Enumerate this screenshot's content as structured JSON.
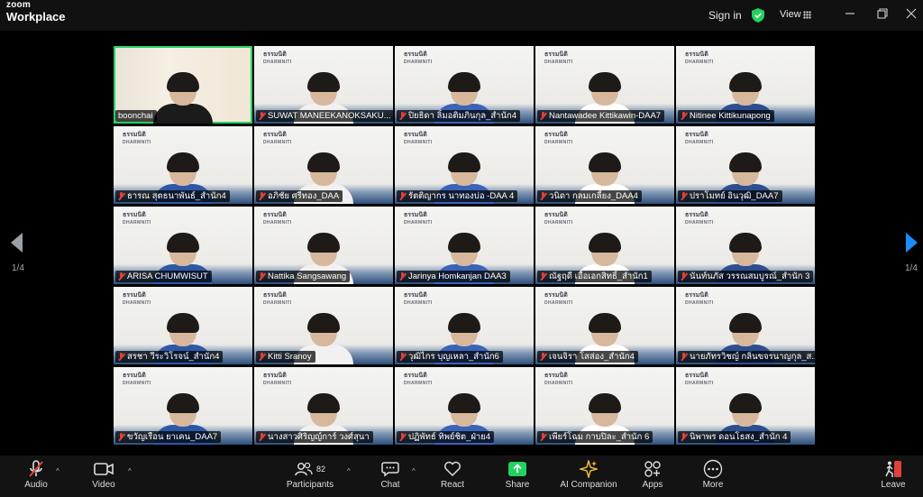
{
  "app": {
    "brand_top": "zoom",
    "brand_bottom": "Workplace",
    "signin": "Sign in",
    "view": "View"
  },
  "pager": {
    "left": "1/4",
    "right": "1/4"
  },
  "colors": {
    "active_border": "#23d160",
    "next_arrow": "#1a8cff",
    "muted_mic": "#e0413b",
    "toolbar_bg": "#131313"
  },
  "logo_text": {
    "thai": "ธรรมนิติ",
    "latin": "DHARMNITI"
  },
  "participants": [
    {
      "name": "boonchai",
      "muted": false,
      "active": true
    },
    {
      "name": "SUWAT MANEEKANOKSAKU...",
      "muted": true
    },
    {
      "name": "ปิยธิดา ลิ้มอติมภินกุล_สำนัก4",
      "muted": true
    },
    {
      "name": "Nantawadee Kittikawin-DAA7",
      "muted": true
    },
    {
      "name": "Nitinee Kittikunapong",
      "muted": true
    },
    {
      "name": "ธารณ สุตธนาพันธ์_สำนัก4",
      "muted": true
    },
    {
      "name": "อภิชัย ศรีทอง_DAA",
      "muted": true
    },
    {
      "name": "รัตติญากร นาทองบ่อ -DAA 4",
      "muted": true
    },
    {
      "name": "วนิดา กลมเกลี้ยง_DAA4",
      "muted": true
    },
    {
      "name": "ปราโมทย์ อินวุฒิ_DAA7",
      "muted": true
    },
    {
      "name": "ARISA CHUMWISUT",
      "muted": true
    },
    {
      "name": "Nattika Sangsawang",
      "muted": true
    },
    {
      "name": "Jarinya Homkanjan DAA3",
      "muted": true
    },
    {
      "name": "ณัฐฤดี เอื้อเอกสิทธิ์_สำนัก1",
      "muted": true
    },
    {
      "name": "นันท์นภัส วรรณสมบูรณ์_สำนัก 3",
      "muted": true
    },
    {
      "name": "สรชา วีระวิโรจน์_สำนัก4",
      "muted": true
    },
    {
      "name": "Kitti Sranoy",
      "muted": true
    },
    {
      "name": "วุฒิไกร บุญเหลา_สำนัก6",
      "muted": true
    },
    {
      "name": "เจนจิรา โสส่อง_สำนัก4",
      "muted": true
    },
    {
      "name": "นายภัทรวิชญ์ กลิ่นขจรนาญกุล_ส...",
      "muted": true
    },
    {
      "name": "ขวัญเรือน ยาเคน_DAA7",
      "muted": true
    },
    {
      "name": "นางสาวศิริญญ์การ์ วงศ์สุนา",
      "muted": true
    },
    {
      "name": "ปฏิพัทธ์ ทิพย์ชิต_ฝ่าย4",
      "muted": true
    },
    {
      "name": "เพียร์โฉม กาบปิละ_สำนัก 6",
      "muted": true
    },
    {
      "name": "นิพาพร ดอนโธสง_สำนัก 4",
      "muted": true
    }
  ],
  "toolbar": {
    "audio": "Audio",
    "video": "Video",
    "participants": "Participants",
    "participant_count": "82",
    "chat": "Chat",
    "react": "React",
    "share": "Share",
    "ai_companion": "AI Companion",
    "apps": "Apps",
    "more": "More",
    "leave": "Leave"
  }
}
